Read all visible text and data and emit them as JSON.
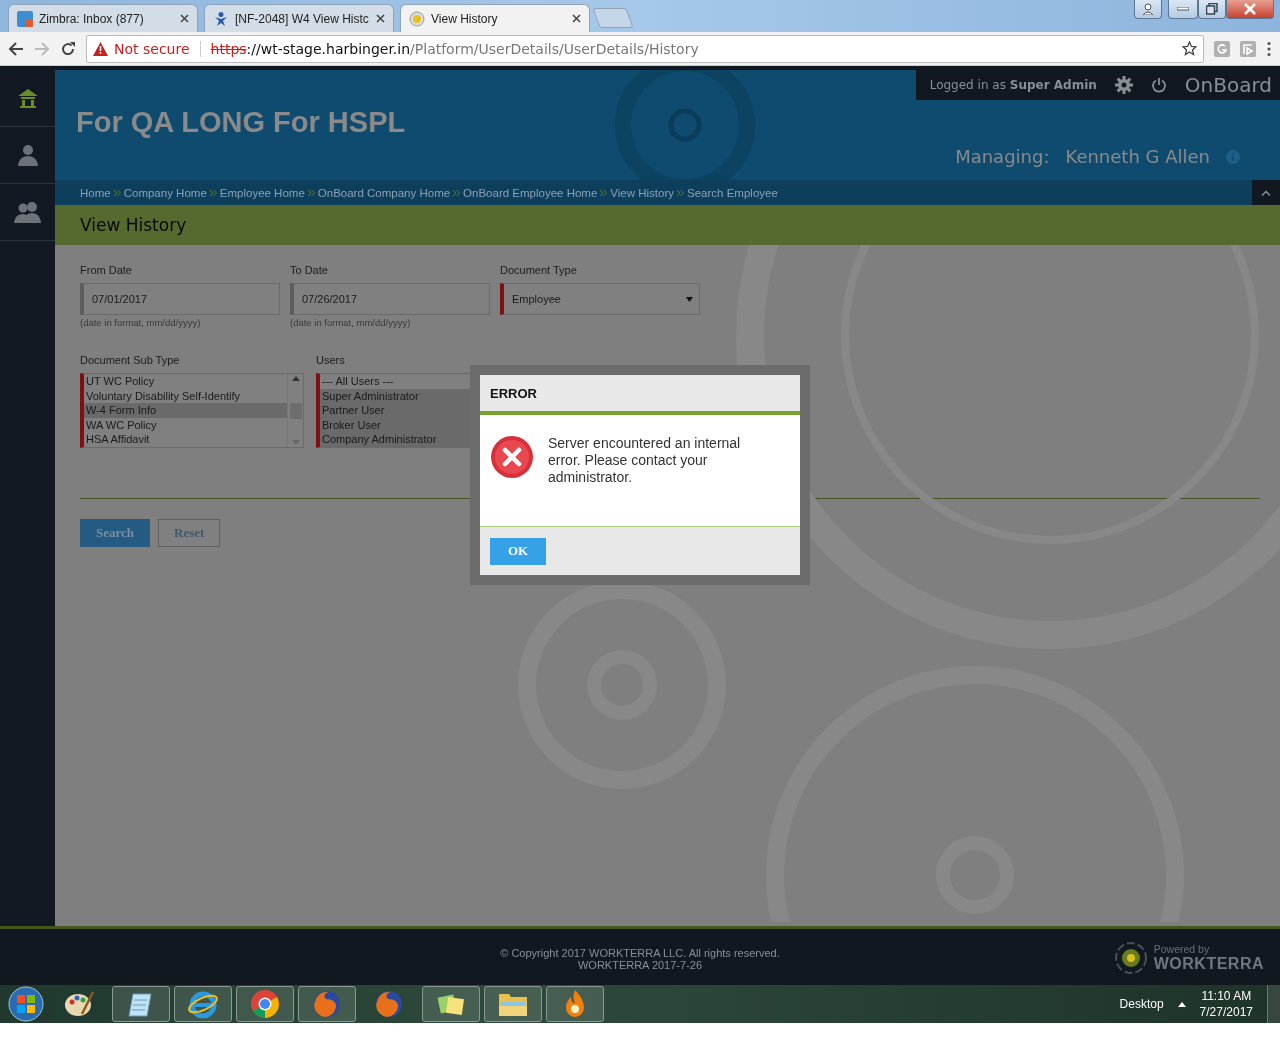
{
  "browser": {
    "tabs": [
      {
        "title": "Zimbra: Inbox (877)",
        "selected": false
      },
      {
        "title": "[NF-2048] W4 View Histc",
        "selected": false
      },
      {
        "title": "View History",
        "selected": true
      }
    ],
    "security": "Not secure",
    "url_scheme": "https",
    "url_host": "://wt-stage.harbinger.in",
    "url_path": "/Platform/UserDetails/UserDetails/History"
  },
  "sidebar": {
    "items": [
      {
        "kind": "home",
        "selected": true
      },
      {
        "kind": "user",
        "selected": false
      },
      {
        "kind": "users",
        "selected": false
      }
    ]
  },
  "header": {
    "user_prefix": "Logged in as",
    "user_name": "Super Admin",
    "app": "OnBoard",
    "company": "For QA LONG For HSPL",
    "managing_label": "Managing:",
    "managing_name": "Kenneth G Allen"
  },
  "breadcrumb": [
    "Home",
    "Company Home",
    "Employee Home",
    "OnBoard Company Home",
    "OnBoard Employee Home",
    "View History",
    "Search Employee"
  ],
  "page_title": "View History",
  "form": {
    "from_date": {
      "label": "From Date",
      "value": "07/01/2017",
      "hint": "(date in format, mm/dd/yyyy)"
    },
    "to_date": {
      "label": "To Date",
      "value": "07/26/2017",
      "hint": "(date in format, mm/dd/yyyy)"
    },
    "document_type": {
      "label": "Document Type",
      "value": "Employee"
    },
    "document_sub_type": {
      "label": "Document Sub Type",
      "items": [
        {
          "label": "UT WC Policy",
          "selected": false
        },
        {
          "label": "Voluntary Disability Self-Identify",
          "selected": false
        },
        {
          "label": "W-4 Form Info",
          "selected": true
        },
        {
          "label": "WA WC Policy",
          "selected": false
        },
        {
          "label": "HSA Affidavit",
          "selected": false
        }
      ]
    },
    "users": {
      "label": "Users",
      "items": [
        {
          "label": "--- All Users ---",
          "selected": false
        },
        {
          "label": "Super Administrator",
          "selected": true
        },
        {
          "label": "Partner User",
          "selected": true
        },
        {
          "label": "Broker User",
          "selected": true
        },
        {
          "label": "Company Administrator",
          "selected": true
        }
      ]
    },
    "buttons": [
      "Search",
      "Reset"
    ]
  },
  "dialog": {
    "title": "ERROR",
    "message": "Server encountered an internal error. Please contact your administrator.",
    "button": "OK"
  },
  "footer": {
    "copyright": "© Copyright 2017 WORKTERRA LLC. All rights reserved.",
    "version": "WORKTERRA 2017-7-26",
    "powered_by": "Powered by",
    "brand": "WORKTERRA"
  },
  "taskbar": {
    "apps": [
      {
        "kind": "paint",
        "open": false
      },
      {
        "kind": "notepad",
        "open": true
      },
      {
        "kind": "ie",
        "open": true
      },
      {
        "kind": "chrome",
        "open": true
      },
      {
        "kind": "firefox",
        "open": true
      },
      {
        "kind": "firefox",
        "open": false
      },
      {
        "kind": "notes",
        "open": true
      },
      {
        "kind": "folder",
        "open": true
      },
      {
        "kind": "flame",
        "open": true
      }
    ],
    "desktop": "Desktop",
    "time": "11:10 AM",
    "date": "7/27/2017"
  }
}
